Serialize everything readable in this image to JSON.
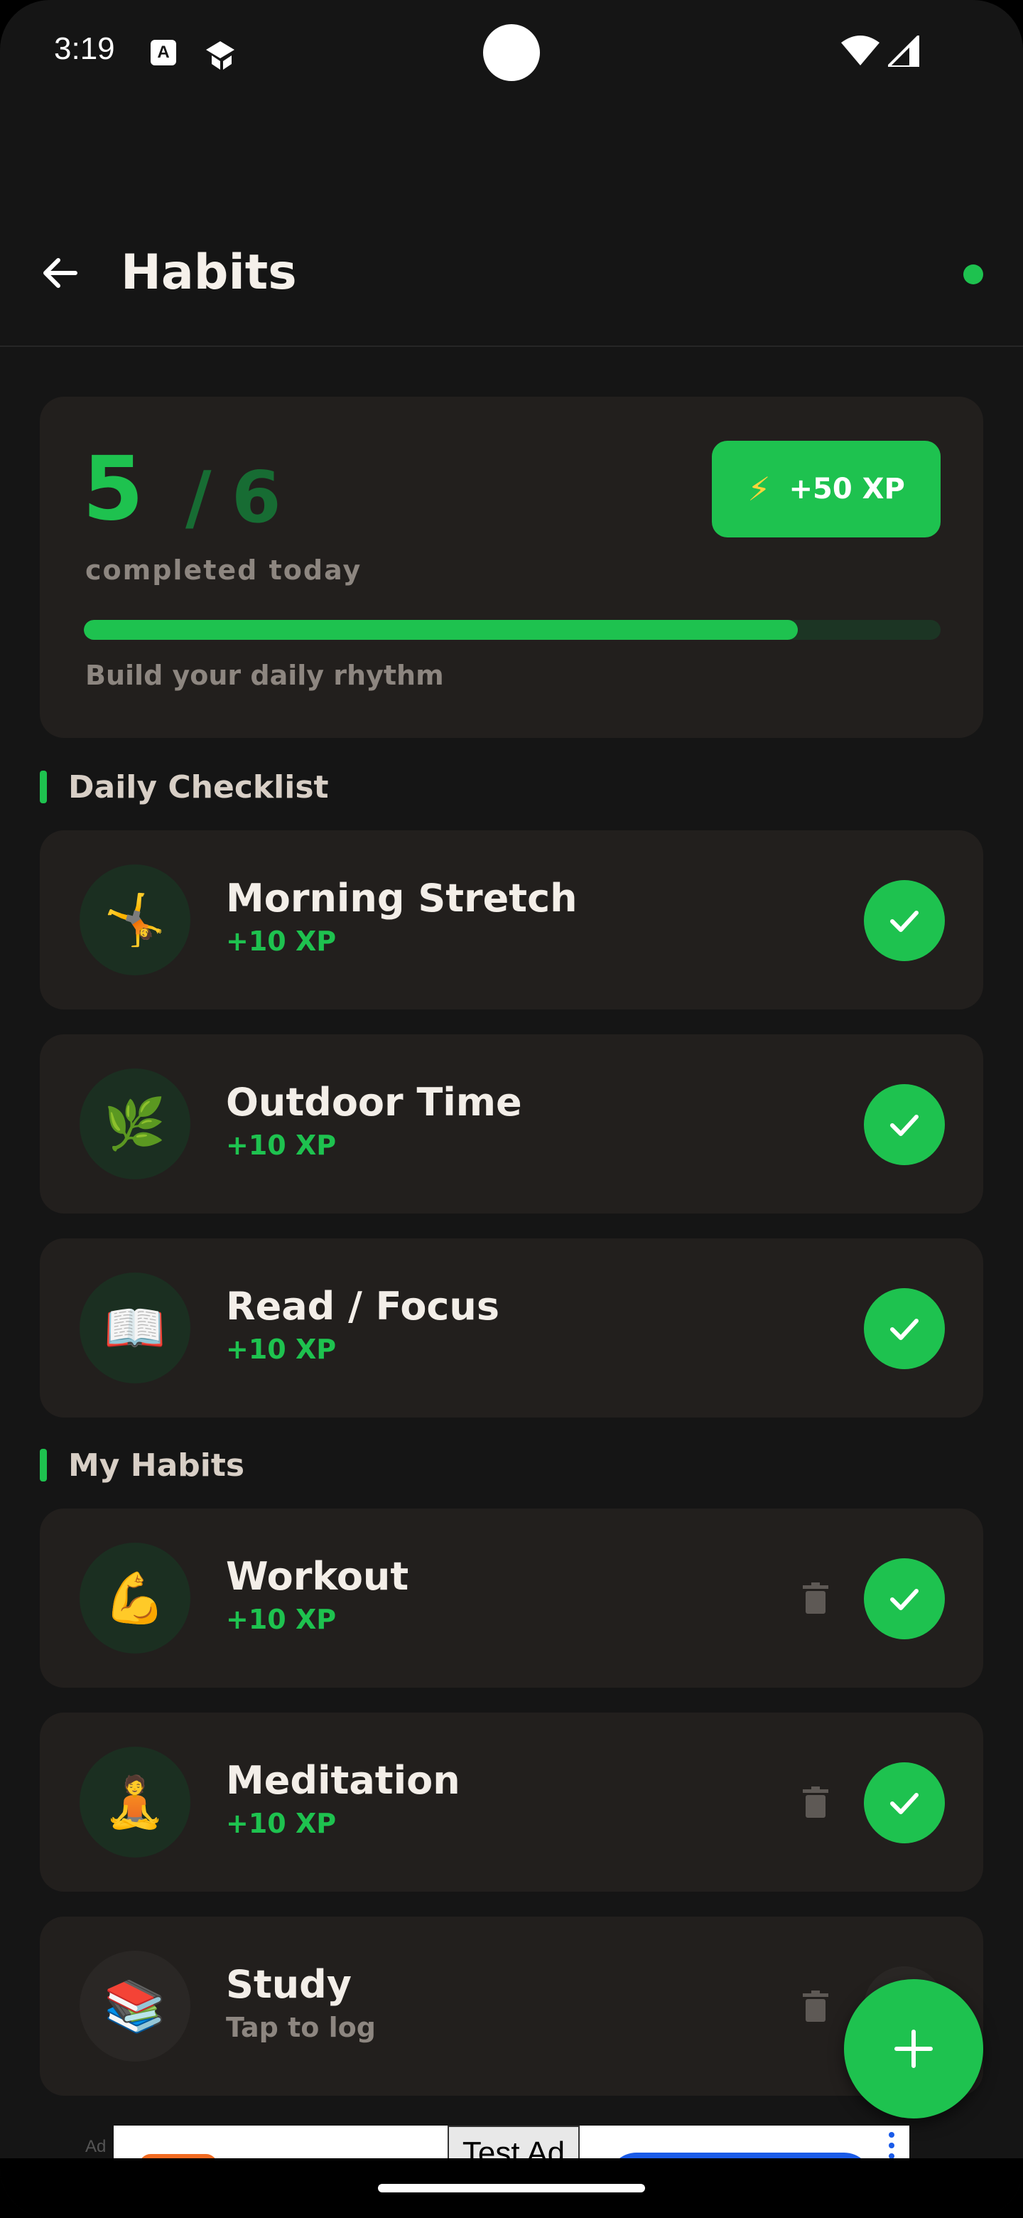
{
  "status_bar": {
    "time": "3:19",
    "notification_icons": [
      "a-box-icon",
      "app-logo-icon"
    ],
    "right_icons": [
      "wifi-icon",
      "signal-icon"
    ]
  },
  "app_bar": {
    "title": "Habits",
    "status_dot_color": "#1ec24f"
  },
  "summary": {
    "completed": "5",
    "separator": "/",
    "total": "6",
    "completed_label": "completed today",
    "xp_badge": "+50 XP",
    "progress_fraction": 0.833,
    "tagline": "Build your daily rhythm"
  },
  "sections": {
    "daily_title": "Daily Checklist",
    "my_title": "My Habits"
  },
  "daily_checklist": [
    {
      "name": "Morning Stretch",
      "xp": "+10 XP",
      "emoji": "🤸",
      "done": true
    },
    {
      "name": "Outdoor Time",
      "xp": "+10 XP",
      "emoji": "🌿",
      "done": true
    },
    {
      "name": "Read / Focus",
      "xp": "+10 XP",
      "emoji": "📖",
      "done": true
    }
  ],
  "my_habits": [
    {
      "name": "Workout",
      "xp": "+10 XP",
      "emoji": "💪",
      "done": true
    },
    {
      "name": "Meditation",
      "xp": "+10 XP",
      "emoji": "🧘",
      "done": true
    },
    {
      "name": "Study",
      "xp": "Tap to log",
      "emoji": "📚",
      "done": false
    }
  ],
  "ad": {
    "label": "Ad",
    "test_label": "Test Ad"
  },
  "colors": {
    "accent": "#1ec24f",
    "card": "#221f1d",
    "background": "#151515"
  }
}
